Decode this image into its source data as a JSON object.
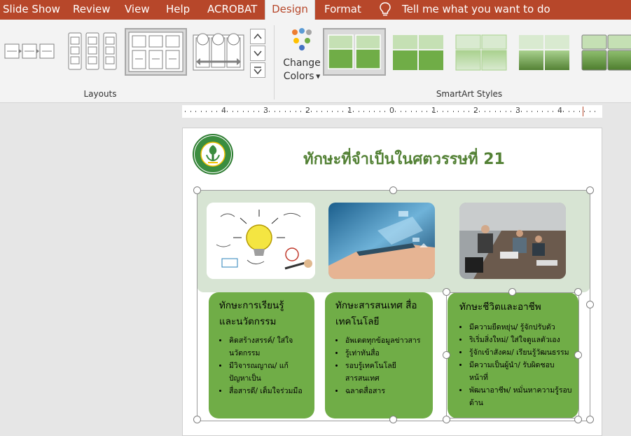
{
  "ribbon_tabs": {
    "slide_show": "Slide Show",
    "review": "Review",
    "view": "View",
    "help": "Help",
    "acrobat": "ACROBAT",
    "design": "Design",
    "format": "Format",
    "tell_me": "Tell me what you want to do"
  },
  "ribbon": {
    "layouts_label": "Layouts",
    "change_colors_line1": "Change",
    "change_colors_line2": "Colors",
    "smartart_styles_label": "SmartArt Styles"
  },
  "ruler": {
    "labels": [
      "4",
      "3",
      "2",
      "1",
      "0",
      "1",
      "2",
      "3",
      "4"
    ]
  },
  "slide": {
    "title": "ทักษะที่จำเป็นในศตวรรษที่ 21",
    "cards": [
      {
        "heading_line1": "ทักษะการเรียนรู้",
        "heading_line2": "และนวัตกรรม",
        "bullets": [
          "คิดสร้างสรรค์/ ใส่ใจนวัตกรรม",
          "มีวิจารณญาณ/ แก้ปัญหาเป็น",
          "สื่อสารดี/ เต็มใจร่วมมือ"
        ]
      },
      {
        "heading_line1": "ทักษะสารสนเทศ สื่อ",
        "heading_line2": "เทคโนโลยี",
        "bullets": [
          "อัพเดตทุกข้อมูลข่าวสาร",
          "รู้เท่าทันสื่อ",
          "รอบรู้เทคโนโลยีสารสนเทศ",
          "ฉลาดสื่อสาร"
        ]
      },
      {
        "heading_line1": "ทักษะชีวิตและอาชีพ",
        "heading_line2": "",
        "bullets": [
          "มีความยืดหยุ่น/ รู้จักปรับตัว",
          "ริเริ่มสิ่งใหม่/ ใส่ใจดูแลตัวเอง",
          "รู้จักเข้าสังคม/ เรียนรู้วัฒนธรรม",
          "มีความเป็นผู้นำ/ รับผิดชอบหน้าที่",
          "พัฒนาอาชีพ/ หมั่นหาความรู้รอบด้าน"
        ]
      }
    ]
  },
  "colors": {
    "tab_bar": "#b7472a",
    "card_green": "#70ad47",
    "title_green": "#538135",
    "banner": "#d7e4d3"
  }
}
